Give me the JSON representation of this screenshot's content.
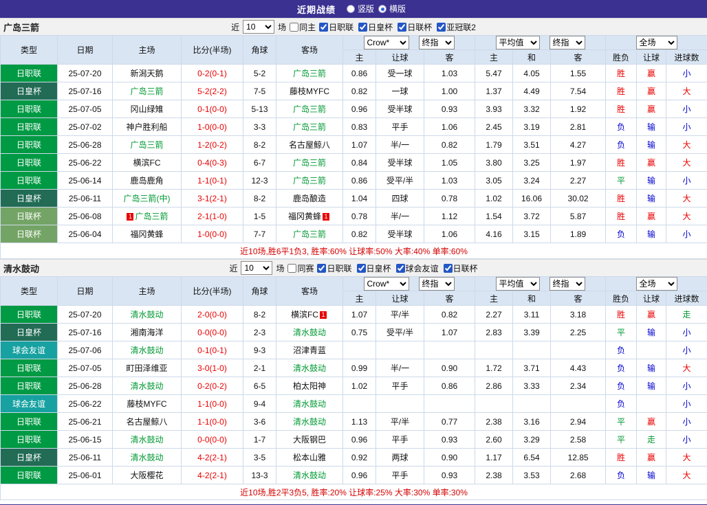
{
  "topbar": {
    "title": "近期战绩",
    "radios": [
      {
        "label": "竖版",
        "selected": false
      },
      {
        "label": "横版",
        "selected": true
      }
    ]
  },
  "text_colors": {
    "focus_team": "#009933",
    "score": "#e80000",
    "summary": "#d40000"
  },
  "league_colors": {
    "日职联": "#009a44",
    "日皇杯": "#226b55",
    "日联杯": "#74a465",
    "球会友谊": "#17a1a1"
  },
  "result_colors": {
    "胜": "#e80000",
    "赢": "#e80000",
    "大": "#e80000",
    "负": "#0000d0",
    "输": "#0000d0",
    "小": "#0000d0",
    "平": "#009933",
    "走": "#009933"
  },
  "sections": [
    {
      "team": "广岛三箭",
      "filter": {
        "near": "近",
        "count": "10",
        "games": "场",
        "extra": "同主",
        "extra_checked": false,
        "leagues": [
          {
            "label": "日职联",
            "checked": true
          },
          {
            "label": "日皇杯",
            "checked": true
          },
          {
            "label": "日联杯",
            "checked": true
          },
          {
            "label": "亚冠联2",
            "checked": true
          }
        ]
      },
      "selects": {
        "company": "Crow*",
        "final1": "终指",
        "avg": "平均值",
        "final2": "终指",
        "scope": "全场"
      },
      "columns": [
        "类型",
        "日期",
        "主场",
        "比分(半场)",
        "角球",
        "客场",
        "主",
        "让球",
        "客",
        "主",
        "和",
        "客",
        "胜负",
        "让球",
        "进球数"
      ],
      "rows": [
        {
          "league": "日职联",
          "date": "25-07-20",
          "home": "新潟天鹅",
          "home_focus": false,
          "score": "0-2(0-1)",
          "corner": "5-2",
          "away": "广岛三箭",
          "away_focus": true,
          "asian_home": "0.86",
          "handicap": "受一球",
          "asian_away": "1.03",
          "euro_home": "5.47",
          "euro_draw": "4.05",
          "euro_away": "1.55",
          "result": "胜",
          "handicap_result": "赢",
          "goals": "小"
        },
        {
          "league": "日皇杯",
          "date": "25-07-16",
          "home": "广岛三箭",
          "home_focus": true,
          "score": "5-2(2-2)",
          "corner": "7-5",
          "away": "藤枝MYFC",
          "away_focus": false,
          "asian_home": "0.82",
          "handicap": "一球",
          "asian_away": "1.00",
          "euro_home": "1.37",
          "euro_draw": "4.49",
          "euro_away": "7.54",
          "result": "胜",
          "handicap_result": "赢",
          "goals": "大"
        },
        {
          "league": "日职联",
          "date": "25-07-05",
          "home": "冈山绿雉",
          "home_focus": false,
          "score": "0-1(0-0)",
          "corner": "5-13",
          "away": "广岛三箭",
          "away_focus": true,
          "asian_home": "0.96",
          "handicap": "受半球",
          "asian_away": "0.93",
          "euro_home": "3.93",
          "euro_draw": "3.32",
          "euro_away": "1.92",
          "result": "胜",
          "handicap_result": "赢",
          "goals": "小"
        },
        {
          "league": "日职联",
          "date": "25-07-02",
          "home": "神户胜利船",
          "home_focus": false,
          "score": "1-0(0-0)",
          "corner": "3-3",
          "away": "广岛三箭",
          "away_focus": true,
          "asian_home": "0.83",
          "handicap": "平手",
          "asian_away": "1.06",
          "euro_home": "2.45",
          "euro_draw": "3.19",
          "euro_away": "2.81",
          "result": "负",
          "handicap_result": "输",
          "goals": "小"
        },
        {
          "league": "日职联",
          "date": "25-06-28",
          "home": "广岛三箭",
          "home_focus": true,
          "score": "1-2(0-2)",
          "corner": "8-2",
          "away": "名古屋鲸八",
          "away_focus": false,
          "asian_home": "1.07",
          "handicap": "半/一",
          "asian_away": "0.82",
          "euro_home": "1.79",
          "euro_draw": "3.51",
          "euro_away": "4.27",
          "result": "负",
          "handicap_result": "输",
          "goals": "大"
        },
        {
          "league": "日职联",
          "date": "25-06-22",
          "home": "横滨FC",
          "home_focus": false,
          "score": "0-4(0-3)",
          "corner": "6-7",
          "away": "广岛三箭",
          "away_focus": true,
          "asian_home": "0.84",
          "handicap": "受半球",
          "asian_away": "1.05",
          "euro_home": "3.80",
          "euro_draw": "3.25",
          "euro_away": "1.97",
          "result": "胜",
          "handicap_result": "赢",
          "goals": "大"
        },
        {
          "league": "日职联",
          "date": "25-06-14",
          "home": "鹿岛鹿角",
          "home_focus": false,
          "score": "1-1(0-1)",
          "corner": "12-3",
          "away": "广岛三箭",
          "away_focus": true,
          "asian_home": "0.86",
          "handicap": "受平/半",
          "asian_away": "1.03",
          "euro_home": "3.05",
          "euro_draw": "3.24",
          "euro_away": "2.27",
          "result": "平",
          "handicap_result": "输",
          "goals": "小"
        },
        {
          "league": "日皇杯",
          "date": "25-06-11",
          "home": "广岛三箭(中)",
          "home_focus": true,
          "score": "3-1(2-1)",
          "corner": "8-2",
          "away": "鹿岛酿造",
          "away_focus": false,
          "asian_home": "1.04",
          "handicap": "四球",
          "asian_away": "0.78",
          "euro_home": "1.02",
          "euro_draw": "16.06",
          "euro_away": "30.02",
          "result": "胜",
          "handicap_result": "输",
          "goals": "大"
        },
        {
          "league": "日联杯",
          "date": "25-06-08",
          "home": "广岛三箭",
          "home_focus": true,
          "home_badge": {
            "text": "1",
            "pos": "pre"
          },
          "score": "2-1(1-0)",
          "corner": "1-5",
          "away": "福冈黄蜂",
          "away_focus": false,
          "away_badge": {
            "text": "1",
            "pos": "post"
          },
          "asian_home": "0.78",
          "handicap": "半/一",
          "asian_away": "1.12",
          "euro_home": "1.54",
          "euro_draw": "3.72",
          "euro_away": "5.87",
          "result": "胜",
          "handicap_result": "赢",
          "goals": "大"
        },
        {
          "league": "日联杯",
          "date": "25-06-04",
          "home": "福冈黄蜂",
          "home_focus": false,
          "score": "1-0(0-0)",
          "corner": "7-7",
          "away": "广岛三箭",
          "away_focus": true,
          "asian_home": "0.82",
          "handicap": "受半球",
          "asian_away": "1.06",
          "euro_home": "4.16",
          "euro_draw": "3.15",
          "euro_away": "1.89",
          "result": "负",
          "handicap_result": "输",
          "goals": "小"
        }
      ],
      "summary": "近10场,胜6平1负3, 胜率:60% 让球率:50% 大率:40% 单率:60%"
    },
    {
      "team": "清水鼓动",
      "filter": {
        "near": "近",
        "count": "10",
        "games": "场",
        "extra": "同赛",
        "extra_checked": false,
        "leagues": [
          {
            "label": "日职联",
            "checked": true
          },
          {
            "label": "日皇杯",
            "checked": true
          },
          {
            "label": "球会友谊",
            "checked": true
          },
          {
            "label": "日联杯",
            "checked": true
          }
        ]
      },
      "selects": {
        "company": "Crow*",
        "final1": "终指",
        "avg": "平均值",
        "final2": "终指",
        "scope": "全场"
      },
      "columns": [
        "类型",
        "日期",
        "主场",
        "比分(半场)",
        "角球",
        "客场",
        "主",
        "让球",
        "客",
        "主",
        "和",
        "客",
        "胜负",
        "让球",
        "进球数"
      ],
      "rows": [
        {
          "league": "日职联",
          "date": "25-07-20",
          "home": "清水鼓动",
          "home_focus": true,
          "score": "2-0(0-0)",
          "corner": "8-2",
          "away": "横滨FC",
          "away_focus": false,
          "away_badge": {
            "text": "1",
            "pos": "post"
          },
          "asian_home": "1.07",
          "handicap": "平/半",
          "asian_away": "0.82",
          "euro_home": "2.27",
          "euro_draw": "3.11",
          "euro_away": "3.18",
          "result": "胜",
          "handicap_result": "赢",
          "goals": "走"
        },
        {
          "league": "日皇杯",
          "date": "25-07-16",
          "home": "湘南海洋",
          "home_focus": false,
          "score": "0-0(0-0)",
          "corner": "2-3",
          "away": "清水鼓动",
          "away_focus": true,
          "asian_home": "0.75",
          "handicap": "受平/半",
          "asian_away": "1.07",
          "euro_home": "2.83",
          "euro_draw": "3.39",
          "euro_away": "2.25",
          "result": "平",
          "handicap_result": "输",
          "goals": "小"
        },
        {
          "league": "球会友谊",
          "date": "25-07-06",
          "home": "清水鼓动",
          "home_focus": true,
          "score": "0-1(0-1)",
          "corner": "9-3",
          "away": "沼津青蓝",
          "away_focus": false,
          "asian_home": "",
          "handicap": "",
          "asian_away": "",
          "euro_home": "",
          "euro_draw": "",
          "euro_away": "",
          "result": "负",
          "handicap_result": "",
          "goals": "小"
        },
        {
          "league": "日职联",
          "date": "25-07-05",
          "home": "町田泽维亚",
          "home_focus": false,
          "score": "3-0(1-0)",
          "corner": "2-1",
          "away": "清水鼓动",
          "away_focus": true,
          "asian_home": "0.99",
          "handicap": "半/一",
          "asian_away": "0.90",
          "euro_home": "1.72",
          "euro_draw": "3.71",
          "euro_away": "4.43",
          "result": "负",
          "handicap_result": "输",
          "goals": "大"
        },
        {
          "league": "日职联",
          "date": "25-06-28",
          "home": "清水鼓动",
          "home_focus": true,
          "score": "0-2(0-2)",
          "corner": "6-5",
          "away": "柏太阳神",
          "away_focus": false,
          "asian_home": "1.02",
          "handicap": "平手",
          "asian_away": "0.86",
          "euro_home": "2.86",
          "euro_draw": "3.33",
          "euro_away": "2.34",
          "result": "负",
          "handicap_result": "输",
          "goals": "小"
        },
        {
          "league": "球会友谊",
          "date": "25-06-22",
          "home": "藤枝MYFC",
          "home_focus": false,
          "score": "1-1(0-0)",
          "corner": "9-4",
          "away": "清水鼓动",
          "away_focus": true,
          "asian_home": "",
          "handicap": "",
          "asian_away": "",
          "euro_home": "",
          "euro_draw": "",
          "euro_away": "",
          "result": "负",
          "handicap_result": "",
          "goals": "小"
        },
        {
          "league": "日职联",
          "date": "25-06-21",
          "home": "名古屋鲸八",
          "home_focus": false,
          "score": "1-1(0-0)",
          "corner": "3-6",
          "away": "清水鼓动",
          "away_focus": true,
          "asian_home": "1.13",
          "handicap": "平/半",
          "asian_away": "0.77",
          "euro_home": "2.38",
          "euro_draw": "3.16",
          "euro_away": "2.94",
          "result": "平",
          "handicap_result": "赢",
          "goals": "小"
        },
        {
          "league": "日职联",
          "date": "25-06-15",
          "home": "清水鼓动",
          "home_focus": true,
          "score": "0-0(0-0)",
          "corner": "1-7",
          "away": "大阪钢巴",
          "away_focus": false,
          "asian_home": "0.96",
          "handicap": "平手",
          "asian_away": "0.93",
          "euro_home": "2.60",
          "euro_draw": "3.29",
          "euro_away": "2.58",
          "result": "平",
          "handicap_result": "走",
          "goals": "小"
        },
        {
          "league": "日皇杯",
          "date": "25-06-11",
          "home": "清水鼓动",
          "home_focus": true,
          "score": "4-2(2-1)",
          "corner": "3-5",
          "away": "松本山雅",
          "away_focus": false,
          "asian_home": "0.92",
          "handicap": "两球",
          "asian_away": "0.90",
          "euro_home": "1.17",
          "euro_draw": "6.54",
          "euro_away": "12.85",
          "result": "胜",
          "handicap_result": "赢",
          "goals": "大"
        },
        {
          "league": "日职联",
          "date": "25-06-01",
          "home": "大阪樱花",
          "home_focus": false,
          "score": "4-2(2-1)",
          "corner": "13-3",
          "away": "清水鼓动",
          "away_focus": true,
          "asian_home": "0.96",
          "handicap": "平手",
          "asian_away": "0.93",
          "euro_home": "2.38",
          "euro_draw": "3.53",
          "euro_away": "2.68",
          "result": "负",
          "handicap_result": "输",
          "goals": "大"
        }
      ],
      "summary": "近10场,胜2平3负5, 胜率:20% 让球率:25% 大率:30% 单率:30%"
    }
  ]
}
